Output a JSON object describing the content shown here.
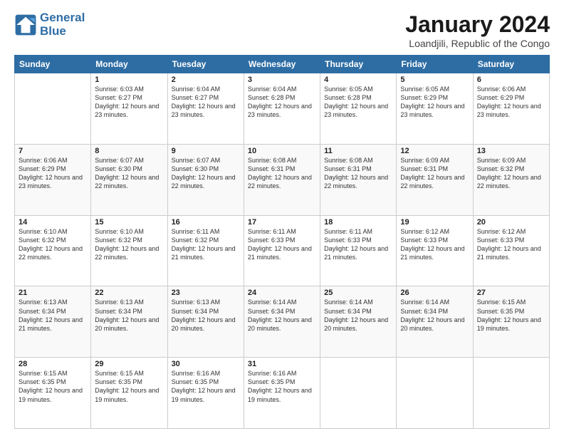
{
  "logo": {
    "line1": "General",
    "line2": "Blue"
  },
  "title": "January 2024",
  "subtitle": "Loandjili, Republic of the Congo",
  "days_of_week": [
    "Sunday",
    "Monday",
    "Tuesday",
    "Wednesday",
    "Thursday",
    "Friday",
    "Saturday"
  ],
  "weeks": [
    [
      {
        "day": "",
        "sunrise": "",
        "sunset": "",
        "daylight": ""
      },
      {
        "day": "1",
        "sunrise": "Sunrise: 6:03 AM",
        "sunset": "Sunset: 6:27 PM",
        "daylight": "Daylight: 12 hours and 23 minutes."
      },
      {
        "day": "2",
        "sunrise": "Sunrise: 6:04 AM",
        "sunset": "Sunset: 6:27 PM",
        "daylight": "Daylight: 12 hours and 23 minutes."
      },
      {
        "day": "3",
        "sunrise": "Sunrise: 6:04 AM",
        "sunset": "Sunset: 6:28 PM",
        "daylight": "Daylight: 12 hours and 23 minutes."
      },
      {
        "day": "4",
        "sunrise": "Sunrise: 6:05 AM",
        "sunset": "Sunset: 6:28 PM",
        "daylight": "Daylight: 12 hours and 23 minutes."
      },
      {
        "day": "5",
        "sunrise": "Sunrise: 6:05 AM",
        "sunset": "Sunset: 6:29 PM",
        "daylight": "Daylight: 12 hours and 23 minutes."
      },
      {
        "day": "6",
        "sunrise": "Sunrise: 6:06 AM",
        "sunset": "Sunset: 6:29 PM",
        "daylight": "Daylight: 12 hours and 23 minutes."
      }
    ],
    [
      {
        "day": "7",
        "sunrise": "Sunrise: 6:06 AM",
        "sunset": "Sunset: 6:29 PM",
        "daylight": "Daylight: 12 hours and 23 minutes."
      },
      {
        "day": "8",
        "sunrise": "Sunrise: 6:07 AM",
        "sunset": "Sunset: 6:30 PM",
        "daylight": "Daylight: 12 hours and 22 minutes."
      },
      {
        "day": "9",
        "sunrise": "Sunrise: 6:07 AM",
        "sunset": "Sunset: 6:30 PM",
        "daylight": "Daylight: 12 hours and 22 minutes."
      },
      {
        "day": "10",
        "sunrise": "Sunrise: 6:08 AM",
        "sunset": "Sunset: 6:31 PM",
        "daylight": "Daylight: 12 hours and 22 minutes."
      },
      {
        "day": "11",
        "sunrise": "Sunrise: 6:08 AM",
        "sunset": "Sunset: 6:31 PM",
        "daylight": "Daylight: 12 hours and 22 minutes."
      },
      {
        "day": "12",
        "sunrise": "Sunrise: 6:09 AM",
        "sunset": "Sunset: 6:31 PM",
        "daylight": "Daylight: 12 hours and 22 minutes."
      },
      {
        "day": "13",
        "sunrise": "Sunrise: 6:09 AM",
        "sunset": "Sunset: 6:32 PM",
        "daylight": "Daylight: 12 hours and 22 minutes."
      }
    ],
    [
      {
        "day": "14",
        "sunrise": "Sunrise: 6:10 AM",
        "sunset": "Sunset: 6:32 PM",
        "daylight": "Daylight: 12 hours and 22 minutes."
      },
      {
        "day": "15",
        "sunrise": "Sunrise: 6:10 AM",
        "sunset": "Sunset: 6:32 PM",
        "daylight": "Daylight: 12 hours and 22 minutes."
      },
      {
        "day": "16",
        "sunrise": "Sunrise: 6:11 AM",
        "sunset": "Sunset: 6:32 PM",
        "daylight": "Daylight: 12 hours and 21 minutes."
      },
      {
        "day": "17",
        "sunrise": "Sunrise: 6:11 AM",
        "sunset": "Sunset: 6:33 PM",
        "daylight": "Daylight: 12 hours and 21 minutes."
      },
      {
        "day": "18",
        "sunrise": "Sunrise: 6:11 AM",
        "sunset": "Sunset: 6:33 PM",
        "daylight": "Daylight: 12 hours and 21 minutes."
      },
      {
        "day": "19",
        "sunrise": "Sunrise: 6:12 AM",
        "sunset": "Sunset: 6:33 PM",
        "daylight": "Daylight: 12 hours and 21 minutes."
      },
      {
        "day": "20",
        "sunrise": "Sunrise: 6:12 AM",
        "sunset": "Sunset: 6:33 PM",
        "daylight": "Daylight: 12 hours and 21 minutes."
      }
    ],
    [
      {
        "day": "21",
        "sunrise": "Sunrise: 6:13 AM",
        "sunset": "Sunset: 6:34 PM",
        "daylight": "Daylight: 12 hours and 21 minutes."
      },
      {
        "day": "22",
        "sunrise": "Sunrise: 6:13 AM",
        "sunset": "Sunset: 6:34 PM",
        "daylight": "Daylight: 12 hours and 20 minutes."
      },
      {
        "day": "23",
        "sunrise": "Sunrise: 6:13 AM",
        "sunset": "Sunset: 6:34 PM",
        "daylight": "Daylight: 12 hours and 20 minutes."
      },
      {
        "day": "24",
        "sunrise": "Sunrise: 6:14 AM",
        "sunset": "Sunset: 6:34 PM",
        "daylight": "Daylight: 12 hours and 20 minutes."
      },
      {
        "day": "25",
        "sunrise": "Sunrise: 6:14 AM",
        "sunset": "Sunset: 6:34 PM",
        "daylight": "Daylight: 12 hours and 20 minutes."
      },
      {
        "day": "26",
        "sunrise": "Sunrise: 6:14 AM",
        "sunset": "Sunset: 6:34 PM",
        "daylight": "Daylight: 12 hours and 20 minutes."
      },
      {
        "day": "27",
        "sunrise": "Sunrise: 6:15 AM",
        "sunset": "Sunset: 6:35 PM",
        "daylight": "Daylight: 12 hours and 19 minutes."
      }
    ],
    [
      {
        "day": "28",
        "sunrise": "Sunrise: 6:15 AM",
        "sunset": "Sunset: 6:35 PM",
        "daylight": "Daylight: 12 hours and 19 minutes."
      },
      {
        "day": "29",
        "sunrise": "Sunrise: 6:15 AM",
        "sunset": "Sunset: 6:35 PM",
        "daylight": "Daylight: 12 hours and 19 minutes."
      },
      {
        "day": "30",
        "sunrise": "Sunrise: 6:16 AM",
        "sunset": "Sunset: 6:35 PM",
        "daylight": "Daylight: 12 hours and 19 minutes."
      },
      {
        "day": "31",
        "sunrise": "Sunrise: 6:16 AM",
        "sunset": "Sunset: 6:35 PM",
        "daylight": "Daylight: 12 hours and 19 minutes."
      },
      {
        "day": "",
        "sunrise": "",
        "sunset": "",
        "daylight": ""
      },
      {
        "day": "",
        "sunrise": "",
        "sunset": "",
        "daylight": ""
      },
      {
        "day": "",
        "sunrise": "",
        "sunset": "",
        "daylight": ""
      }
    ]
  ]
}
